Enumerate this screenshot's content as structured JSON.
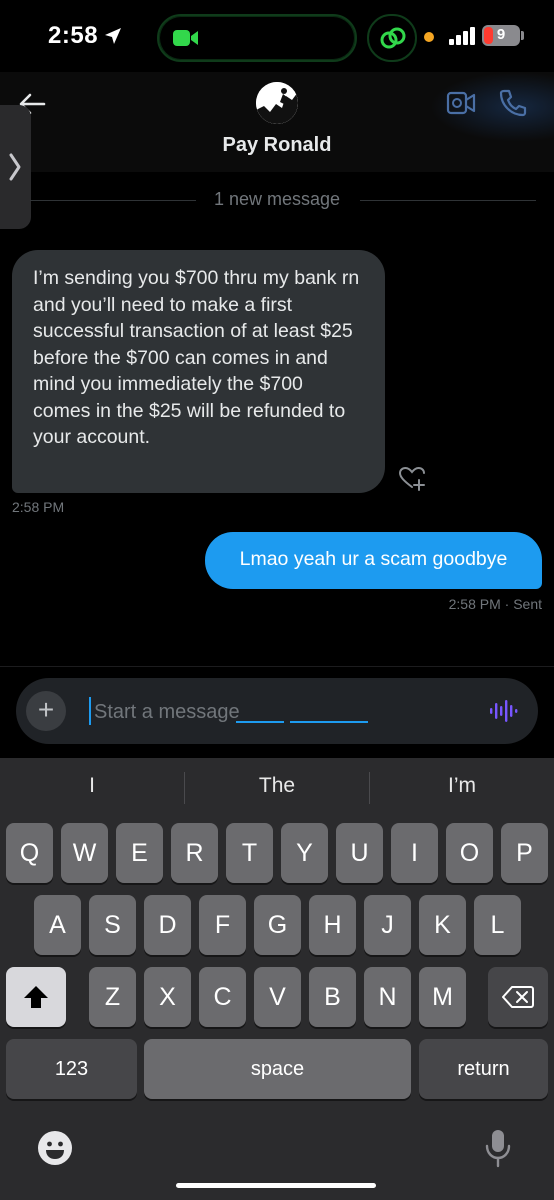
{
  "status_bar": {
    "time": "2:58",
    "battery_level": "9",
    "icons": [
      "location-arrow-icon",
      "facetime-video-icon",
      "linked-chain-icon",
      "signal-bars-icon",
      "battery-icon"
    ]
  },
  "header": {
    "contact_name": "Pay Ronald",
    "icons": [
      "back-arrow-icon",
      "video-call-icon",
      "phone-call-icon"
    ]
  },
  "messages": {
    "divider_label": "1 new message",
    "incoming": {
      "text": "I’m sending you $700 thru my bank rn and you’ll need to make a first successful transaction of at least $25 before the $700 can comes in and mind you immediately the $700 comes in the $25 will be refunded to your account.",
      "time": "2:58 PM"
    },
    "outgoing": {
      "text": "Lmao yeah ur a scam goodbye",
      "meta": "2:58 PM · Sent"
    }
  },
  "composer": {
    "placeholder": "Start a message",
    "value": ""
  },
  "keyboard": {
    "suggestions": [
      "I",
      "The",
      "I’m"
    ],
    "row1": [
      "Q",
      "W",
      "E",
      "R",
      "T",
      "Y",
      "U",
      "I",
      "O",
      "P"
    ],
    "row2": [
      "A",
      "S",
      "D",
      "F",
      "G",
      "H",
      "J",
      "K",
      "L"
    ],
    "row3": [
      "Z",
      "X",
      "C",
      "V",
      "B",
      "N",
      "M"
    ],
    "numbers_label": "123",
    "space_label": "space",
    "return_label": "return"
  },
  "colors": {
    "accent": "#1d9bf0",
    "incoming_bubble": "#2f3336",
    "keyboard_bg": "#2b2b2d",
    "key_bg": "#6b6b6e"
  }
}
